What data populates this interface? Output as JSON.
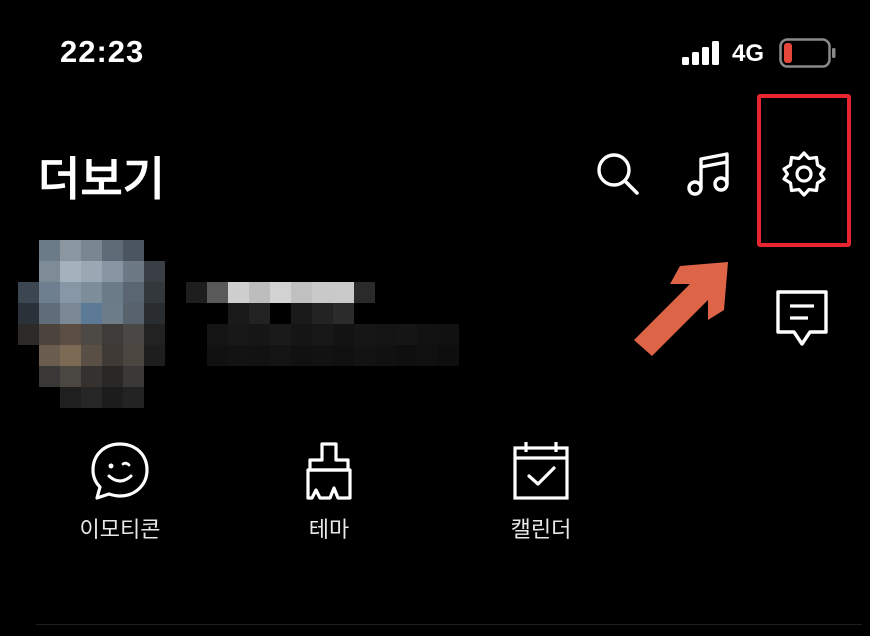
{
  "status_bar": {
    "time": "22:23",
    "network": "4G",
    "battery_level": 0.1,
    "battery_color": "#e5473b"
  },
  "header": {
    "title": "더보기",
    "icons": [
      "search-icon",
      "music-icon",
      "gear-icon"
    ]
  },
  "profile": {
    "status_icon": "message-icon",
    "pixelated": true
  },
  "quick_menu": [
    {
      "label": "이모티콘",
      "icon": "smiley-icon"
    },
    {
      "label": "테마",
      "icon": "brush-icon"
    },
    {
      "label": "캘린더",
      "icon": "calendar-check-icon"
    }
  ],
  "colors": {
    "background": "#000000",
    "highlight": "#e8252f",
    "arrow": "#dd6446",
    "text": "#ffffff"
  }
}
